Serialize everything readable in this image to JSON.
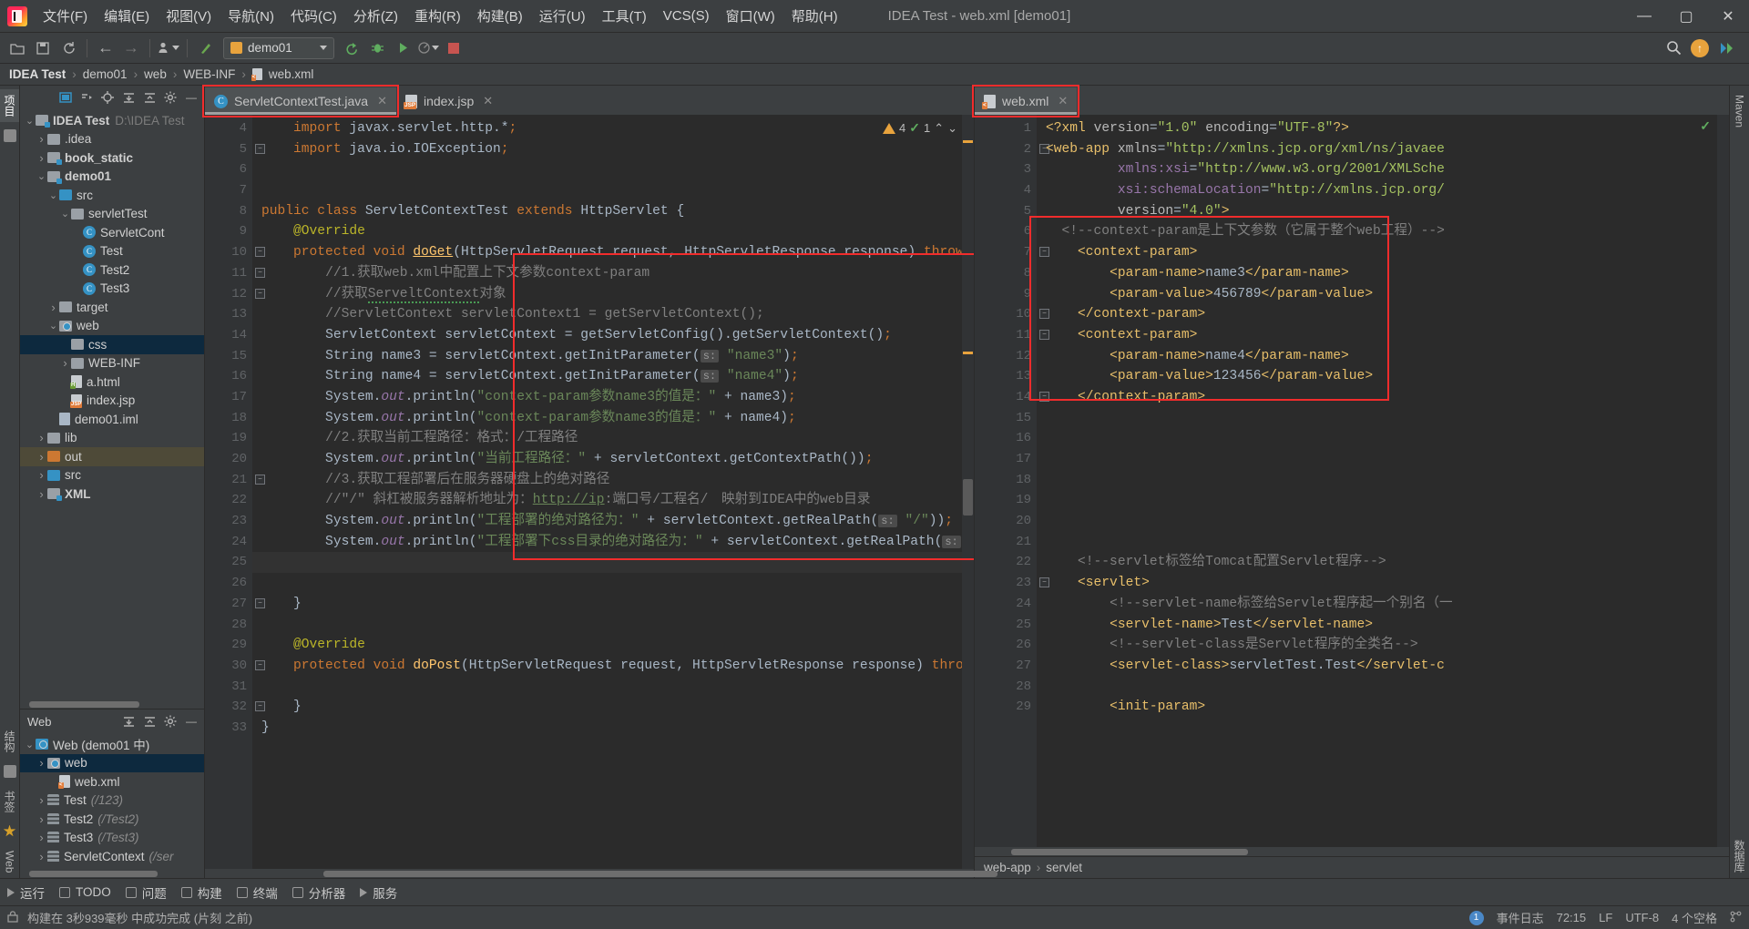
{
  "titlebar": {
    "menus": [
      "文件(F)",
      "编辑(E)",
      "视图(V)",
      "导航(N)",
      "代码(C)",
      "分析(Z)",
      "重构(R)",
      "构建(B)",
      "运行(U)",
      "工具(T)",
      "VCS(S)",
      "窗口(W)",
      "帮助(H)"
    ],
    "window_title": "IDEA Test - web.xml [demo01]",
    "minimize": "—",
    "maximize": "▢",
    "close": "✕"
  },
  "toolbar": {
    "open_icon": "open-icon",
    "save_icon": "save-icon",
    "sync_icon": "sync-icon",
    "back_icon": "←",
    "forward_icon": "→",
    "profile_icon": "profile-icon",
    "build_icon": "build-icon",
    "run_config_label": "demo01",
    "run_icon": "run-icon",
    "debug_icon": "debug-icon",
    "coverage_icon": "coverage-icon",
    "profiler_icon": "profiler-icon",
    "stop_icon": "stop-icon",
    "search_icon": "search-icon",
    "update_icon": "update-icon",
    "plugin_icon": "plugin-icon"
  },
  "breadcrumb": {
    "items": [
      "IDEA Test",
      "demo01",
      "web",
      "WEB-INF",
      "web.xml"
    ],
    "separator": "›"
  },
  "left_rail": {
    "tabs": [
      "项目",
      "收藏"
    ],
    "bottom_tabs": [
      "结构",
      "书签",
      "Web"
    ]
  },
  "right_rail": {
    "tabs": [
      "Maven",
      "数据库"
    ]
  },
  "project_panel": {
    "title": "",
    "icons": [
      "select-opened-file-icon",
      "flatten-icon",
      "locate-icon",
      "expand-all-icon",
      "collapse-all-icon",
      "settings-icon",
      "hide-icon"
    ],
    "tree": [
      {
        "label": "IDEA Test",
        "path": "D:\\IDEA Test",
        "indent": 0,
        "arrow": "v",
        "icon": "folder-module",
        "bold": true
      },
      {
        "label": ".idea",
        "indent": 1,
        "arrow": ">",
        "icon": "folder-gray",
        "bold": false
      },
      {
        "label": "book_static",
        "indent": 1,
        "arrow": ">",
        "icon": "folder-module",
        "bold": true
      },
      {
        "label": "demo01",
        "indent": 1,
        "arrow": "v",
        "icon": "folder-module",
        "bold": true
      },
      {
        "label": "src",
        "indent": 2,
        "arrow": "v",
        "icon": "folder-blue",
        "bold": false
      },
      {
        "label": "servletTest",
        "indent": 3,
        "arrow": "v",
        "icon": "folder-package",
        "bold": false
      },
      {
        "label": "ServletCont",
        "indent": 4,
        "arrow": "",
        "icon": "class",
        "bold": false
      },
      {
        "label": "Test",
        "indent": 4,
        "arrow": "",
        "icon": "class",
        "bold": false
      },
      {
        "label": "Test2",
        "indent": 4,
        "arrow": "",
        "icon": "class",
        "bold": false
      },
      {
        "label": "Test3",
        "indent": 4,
        "arrow": "",
        "icon": "class",
        "bold": false
      },
      {
        "label": "target",
        "indent": 2,
        "arrow": ">",
        "icon": "folder-gray",
        "bold": false
      },
      {
        "label": "web",
        "indent": 2,
        "arrow": "v",
        "icon": "folder-web",
        "bold": false
      },
      {
        "label": "css",
        "indent": 3,
        "arrow": "",
        "icon": "folder-gray",
        "bold": false,
        "selected": true
      },
      {
        "label": "WEB-INF",
        "indent": 3,
        "arrow": ">",
        "icon": "folder-gray",
        "bold": false
      },
      {
        "label": "a.html",
        "indent": 3,
        "arrow": "",
        "icon": "file-html",
        "bold": false
      },
      {
        "label": "index.jsp",
        "indent": 3,
        "arrow": "",
        "icon": "file-jsp",
        "bold": false
      },
      {
        "label": "demo01.iml",
        "indent": 2,
        "arrow": "",
        "icon": "file-iml",
        "bold": false
      },
      {
        "label": "lib",
        "indent": 1,
        "arrow": ">",
        "icon": "folder-gray",
        "bold": false
      },
      {
        "label": "out",
        "indent": 1,
        "arrow": ">",
        "icon": "folder-orange",
        "bold": false,
        "highlight": true
      },
      {
        "label": "src",
        "indent": 1,
        "arrow": ">",
        "icon": "folder-blue",
        "bold": false
      },
      {
        "label": "XML",
        "indent": 1,
        "arrow": ">",
        "icon": "folder-module",
        "bold": true
      }
    ]
  },
  "web_panel": {
    "title": "Web",
    "icons": [
      "expand-all-icon",
      "collapse-all-icon",
      "settings-icon",
      "hide-icon"
    ],
    "tree": [
      {
        "label": "Web (demo01 中)",
        "indent": 0,
        "arrow": "v",
        "icon": "web-module"
      },
      {
        "label": "web",
        "indent": 1,
        "arrow": ">",
        "icon": "folder-web",
        "selected": true
      },
      {
        "label": "web.xml",
        "indent": 2,
        "arrow": "",
        "icon": "file-xml"
      },
      {
        "label": "Test",
        "suffix": "(/123)",
        "indent": 1,
        "arrow": ">",
        "icon": "servlet"
      },
      {
        "label": "Test2",
        "suffix": "(/Test2)",
        "indent": 1,
        "arrow": ">",
        "icon": "servlet"
      },
      {
        "label": "Test3",
        "suffix": "(/Test3)",
        "indent": 1,
        "arrow": ">",
        "icon": "servlet"
      },
      {
        "label": "ServletContext",
        "suffix": "(/ser",
        "indent": 1,
        "arrow": ">",
        "icon": "servlet"
      }
    ]
  },
  "editor_java": {
    "tabs": [
      {
        "label": "ServletContextTest.java",
        "icon": "java-class-icon",
        "active": true,
        "highlighted": true
      },
      {
        "label": "index.jsp",
        "icon": "jsp-file-icon",
        "active": false,
        "highlighted": false
      }
    ],
    "inspection": {
      "warn_count": "4",
      "ok_count": "1",
      "up": "⌃",
      "down": "⌄"
    },
    "first_line": 4,
    "lines": [
      {
        "n": 4,
        "html": "    <span class='kw'>import</span> javax.servlet.http.*<span class='sem'>;</span>"
      },
      {
        "n": 5,
        "html": "    <span class='kw'>import</span> java.io.IOException<span class='sem'>;</span>"
      },
      {
        "n": 6,
        "html": ""
      },
      {
        "n": 7,
        "html": ""
      },
      {
        "n": 8,
        "html": "<span class='kw'>public class</span> <span class='cls'>ServletContextTest</span> <span class='kw'>extends</span> <span class='cls'>HttpServlet</span> {"
      },
      {
        "n": 9,
        "html": "    <span class='ann'>@Override</span>"
      },
      {
        "n": 10,
        "html": "    <span class='kw'>protected void</span> <span class='fn' style='text-decoration:underline'>doGet</span>(<span class='cls'>HttpServletRequest</span> request, <span class='cls'>HttpServletResponse</span> response) <span class='kw'>throws</span> <span class='cls'>ServletE</span>"
      },
      {
        "n": 11,
        "html": "        <span class='cmt'>//1.获取web.xml中配置上下文参数context-param</span>"
      },
      {
        "n": 12,
        "html": "        <span class='cmt'>//获取<span class='squig'>ServeltContext</span>对象</span>"
      },
      {
        "n": 13,
        "html": "        <span class='cmt'>//ServletContext servletContext1 = getServletContext();</span>"
      },
      {
        "n": 14,
        "html": "        <span class='cls'>ServletContext</span> servletContext = getServletConfig().getServletContext()<span class='sem'>;</span>"
      },
      {
        "n": 15,
        "html": "        <span class='cls'>String</span> name3 = servletContext.getInitParameter(<span class='hint'>s:</span> <span class='str'>\"name3\"</span>)<span class='sem'>;</span>"
      },
      {
        "n": 16,
        "html": "        <span class='cls'>String</span> name4 = servletContext.getInitParameter(<span class='hint'>s:</span> <span class='str'>\"name4\"</span>)<span class='sem'>;</span>"
      },
      {
        "n": 17,
        "html": "        System.<span class='fld'>out</span>.println(<span class='str'>\"context-param参数name3的值是：\"</span> + name3)<span class='sem'>;</span>"
      },
      {
        "n": 18,
        "html": "        System.<span class='fld'>out</span>.println(<span class='str'>\"context-param参数name3的值是：\"</span> + name4)<span class='sem'>;</span>"
      },
      {
        "n": 19,
        "html": "        <span class='cmt'>//2.获取当前工程路径：格式：/工程路径</span>"
      },
      {
        "n": 20,
        "html": "        System.<span class='fld'>out</span>.println(<span class='str'>\"当前工程路径：\"</span> + servletContext.getContextPath())<span class='sem'>;</span>"
      },
      {
        "n": 21,
        "html": "        <span class='cmt'>//3.获取工程部署后在服务器硬盘上的绝对路径</span>"
      },
      {
        "n": 22,
        "html": "        <span class='cmt'>//\"/\" 斜杠被服务器解析地址为：<span class='lnk'>http://ip</span>:端口号/工程名/　映射到IDEA中的web目录</span>"
      },
      {
        "n": 23,
        "html": "        System.<span class='fld'>out</span>.println(<span class='str'>\"工程部署的绝对路径为：\"</span> + servletContext.getRealPath(<span class='hint'>s:</span> <span class='str'>\"/\"</span>))<span class='sem'>;</span>"
      },
      {
        "n": 24,
        "html": "        System.<span class='fld'>out</span>.println(<span class='str'>\"工程部署下css目录的绝对路径为：\"</span> + servletContext.getRealPath(<span class='hint'>s:</span> <span class='str'>\"/css\"</span>))<span class='sem'>;</span>"
      },
      {
        "n": 25,
        "html": "",
        "current": true
      },
      {
        "n": 26,
        "html": ""
      },
      {
        "n": 27,
        "html": "    }"
      },
      {
        "n": 28,
        "html": ""
      },
      {
        "n": 29,
        "html": "    <span class='ann'>@Override</span>"
      },
      {
        "n": 30,
        "html": "    <span class='kw'>protected void</span> <span class='fn'>doPost</span>(<span class='cls'>HttpServletRequest</span> request, <span class='cls'>HttpServletResponse</span> response) <span class='kw'>throws</span> <span class='cls'>Servlet</span>"
      },
      {
        "n": 31,
        "html": ""
      },
      {
        "n": 32,
        "html": "    }"
      },
      {
        "n": 33,
        "html": "}"
      }
    ]
  },
  "editor_xml": {
    "tabs": [
      {
        "label": "web.xml",
        "icon": "xml-file-icon",
        "active": true,
        "highlighted": true
      }
    ],
    "ok_icon": "✓",
    "lines": [
      {
        "n": 1,
        "html": "<span class='xtag'>&lt;?xml</span> <span class='xattr'>version</span>=<span class='xval'>\"1.0\"</span> <span class='xattr'>encoding</span>=<span class='xval'>\"UTF-8\"</span><span class='xtag'>?&gt;</span>"
      },
      {
        "n": 2,
        "html": "<span class='xtag'>&lt;web-app</span> <span class='xattr'>xmlns</span>=<span class='xval'>\"http://xmlns.jcp.org/xml/ns/javaee</span>"
      },
      {
        "n": 3,
        "html": "         <span class='xns'>xmlns:xsi</span>=<span class='xval'>\"http://www.w3.org/2001/XMLSche</span>"
      },
      {
        "n": 4,
        "html": "         <span class='xns'>xsi:schemaLocation</span>=<span class='xval'>\"http://xmlns.jcp.org/</span>"
      },
      {
        "n": 5,
        "html": "         <span class='xattr'>version</span>=<span class='xval'>\"4.0\"</span><span class='xtag'>&gt;</span>"
      },
      {
        "n": 6,
        "html": "  <span class='cmt'>&lt;!--context-param是上下文参数（它属于整个web工程）--&gt;</span>"
      },
      {
        "n": 7,
        "html": "    <span class='xtag'>&lt;context-param&gt;</span>"
      },
      {
        "n": 8,
        "html": "        <span class='xtag'>&lt;param-name&gt;</span>name3<span class='xtag'>&lt;/param-name&gt;</span>"
      },
      {
        "n": 9,
        "html": "        <span class='xtag'>&lt;param-value&gt;</span>456789<span class='xtag'>&lt;/param-value&gt;</span>"
      },
      {
        "n": 10,
        "html": "    <span class='xtag'>&lt;/context-param&gt;</span>"
      },
      {
        "n": 11,
        "html": "    <span class='xtag'>&lt;context-param&gt;</span>"
      },
      {
        "n": 12,
        "html": "        <span class='xtag'>&lt;param-name&gt;</span>name4<span class='xtag'>&lt;/param-name&gt;</span>"
      },
      {
        "n": 13,
        "html": "        <span class='xtag'>&lt;param-value&gt;</span>123456<span class='xtag'>&lt;/param-value&gt;</span>"
      },
      {
        "n": 14,
        "html": "    <span class='xtag'>&lt;/context-param&gt;</span>"
      },
      {
        "n": 15,
        "html": ""
      },
      {
        "n": 16,
        "html": ""
      },
      {
        "n": 17,
        "html": ""
      },
      {
        "n": 18,
        "html": ""
      },
      {
        "n": 19,
        "html": ""
      },
      {
        "n": 20,
        "html": ""
      },
      {
        "n": 21,
        "html": ""
      },
      {
        "n": 22,
        "html": "    <span class='cmt'>&lt;!--servlet标签给Tomcat配置Servlet程序--&gt;</span>"
      },
      {
        "n": 23,
        "html": "    <span class='xtag'>&lt;servlet&gt;</span>"
      },
      {
        "n": 24,
        "html": "        <span class='cmt'>&lt;!--servlet-name标签给Servlet程序起一个别名（一</span>"
      },
      {
        "n": 25,
        "html": "        <span class='xtag'>&lt;servlet-name&gt;</span>Test<span class='xtag'>&lt;/servlet-name&gt;</span>"
      },
      {
        "n": 26,
        "html": "        <span class='cmt'>&lt;!--servlet-class是Servlet程序的全类名--&gt;</span>"
      },
      {
        "n": 27,
        "html": "        <span class='xtag'>&lt;servlet-class&gt;</span>servletTest.Test<span class='xtag'>&lt;/servlet-c</span>"
      },
      {
        "n": 28,
        "html": ""
      },
      {
        "n": 29,
        "html": "        <span class='xtag'>&lt;init-param&gt;</span>"
      }
    ],
    "breadcrumb": [
      "web-app",
      "servlet"
    ],
    "breadcrumb_sep": "›"
  },
  "toolwindows": {
    "items": [
      {
        "label": "运行",
        "icon": "run-icon"
      },
      {
        "label": "TODO",
        "icon": "todo-icon"
      },
      {
        "label": "问题",
        "icon": "problems-icon"
      },
      {
        "label": "构建",
        "icon": "build-icon"
      },
      {
        "label": "终端",
        "icon": "terminal-icon"
      },
      {
        "label": "分析器",
        "icon": "profiler-icon"
      },
      {
        "label": "服务",
        "icon": "services-icon"
      }
    ]
  },
  "statusbar": {
    "message": "构建在 3秒939毫秒 中成功完成 (片刻 之前)",
    "event_log": "事件日志",
    "event_badge": "1",
    "caret": "72:15",
    "line_sep": "LF",
    "encoding": "UTF-8",
    "indent": "4 个空格",
    "lock_icon": "lock-icon",
    "branch_icon": "branch-icon"
  }
}
